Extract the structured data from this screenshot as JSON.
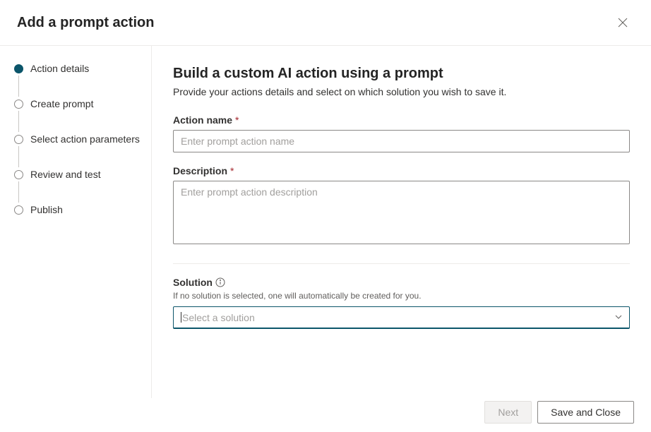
{
  "header": {
    "title": "Add a prompt action"
  },
  "sidebar": {
    "steps": [
      {
        "label": "Action details",
        "active": true
      },
      {
        "label": "Create prompt",
        "active": false
      },
      {
        "label": "Select action parameters",
        "active": false
      },
      {
        "label": "Review and test",
        "active": false
      },
      {
        "label": "Publish",
        "active": false
      }
    ]
  },
  "main": {
    "title": "Build a custom AI action using a prompt",
    "subtitle": "Provide your actions details and select on which solution you wish to save it.",
    "action_name": {
      "label": "Action name",
      "required_mark": "*",
      "placeholder": "Enter prompt action name",
      "value": ""
    },
    "description": {
      "label": "Description",
      "required_mark": "*",
      "placeholder": "Enter prompt action description",
      "value": ""
    },
    "solution": {
      "label": "Solution",
      "help": "If no solution is selected, one will automatically be created for you.",
      "placeholder": "Select a solution",
      "value": ""
    }
  },
  "footer": {
    "next_label": "Next",
    "save_close_label": "Save and Close"
  }
}
